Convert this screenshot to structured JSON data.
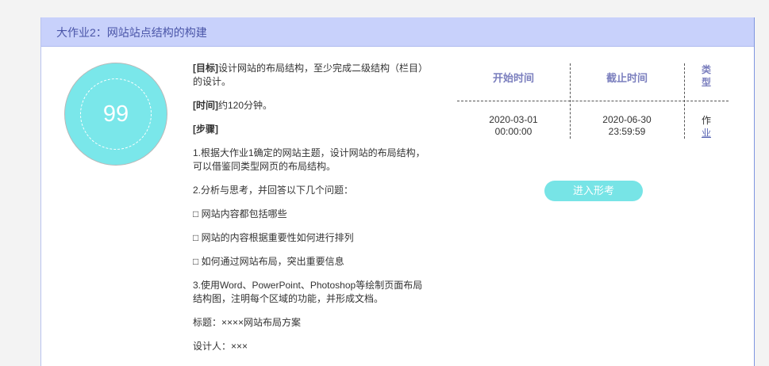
{
  "assignment": {
    "title": "大作业2：网站站点结构的构建",
    "score": "99"
  },
  "description": {
    "goal_label": "[目标]",
    "goal_text": "设计网站的布局结构，至少完成二级结构（栏目）的设计。",
    "time_label": "[时间]",
    "time_text": "约120分钟。",
    "steps_label": "[步骤]",
    "step1": "1.根据大作业1确定的网站主题，设计网站的布局结构，可以借鉴同类型网页的布局结构。",
    "step2": "2.分析与思考，并回答以下几个问题：",
    "q1": "□ 网站内容都包括哪些",
    "q2": "□ 网站的内容根据重要性如何进行排列",
    "q3": "□ 如何通过网站布局，突出重要信息",
    "step3": "3.使用Word、PowerPoint、Photoshop等绘制页面布局结构图，注明每个区域的功能，并形成文档。",
    "title_line": "标题：××××网站布局方案",
    "designer_line": "设计人：×××"
  },
  "info": {
    "start_header": "开始时间",
    "end_header": "截止时间",
    "type_header": "类型",
    "start_date": "2020-03-01",
    "start_time": "00:00:00",
    "end_date": "2020-06-30",
    "end_time": "23:59:59",
    "type_value_1": "作",
    "type_value_2": "业"
  },
  "actions": {
    "enter_label": "进入形考"
  },
  "colors": {
    "header_bg": "#c8d1fb",
    "title_text": "#4a55a8",
    "score_circle": "#7ae7ea",
    "button_bg": "#77e4e6",
    "table_header_text": "#7b7fbe"
  }
}
